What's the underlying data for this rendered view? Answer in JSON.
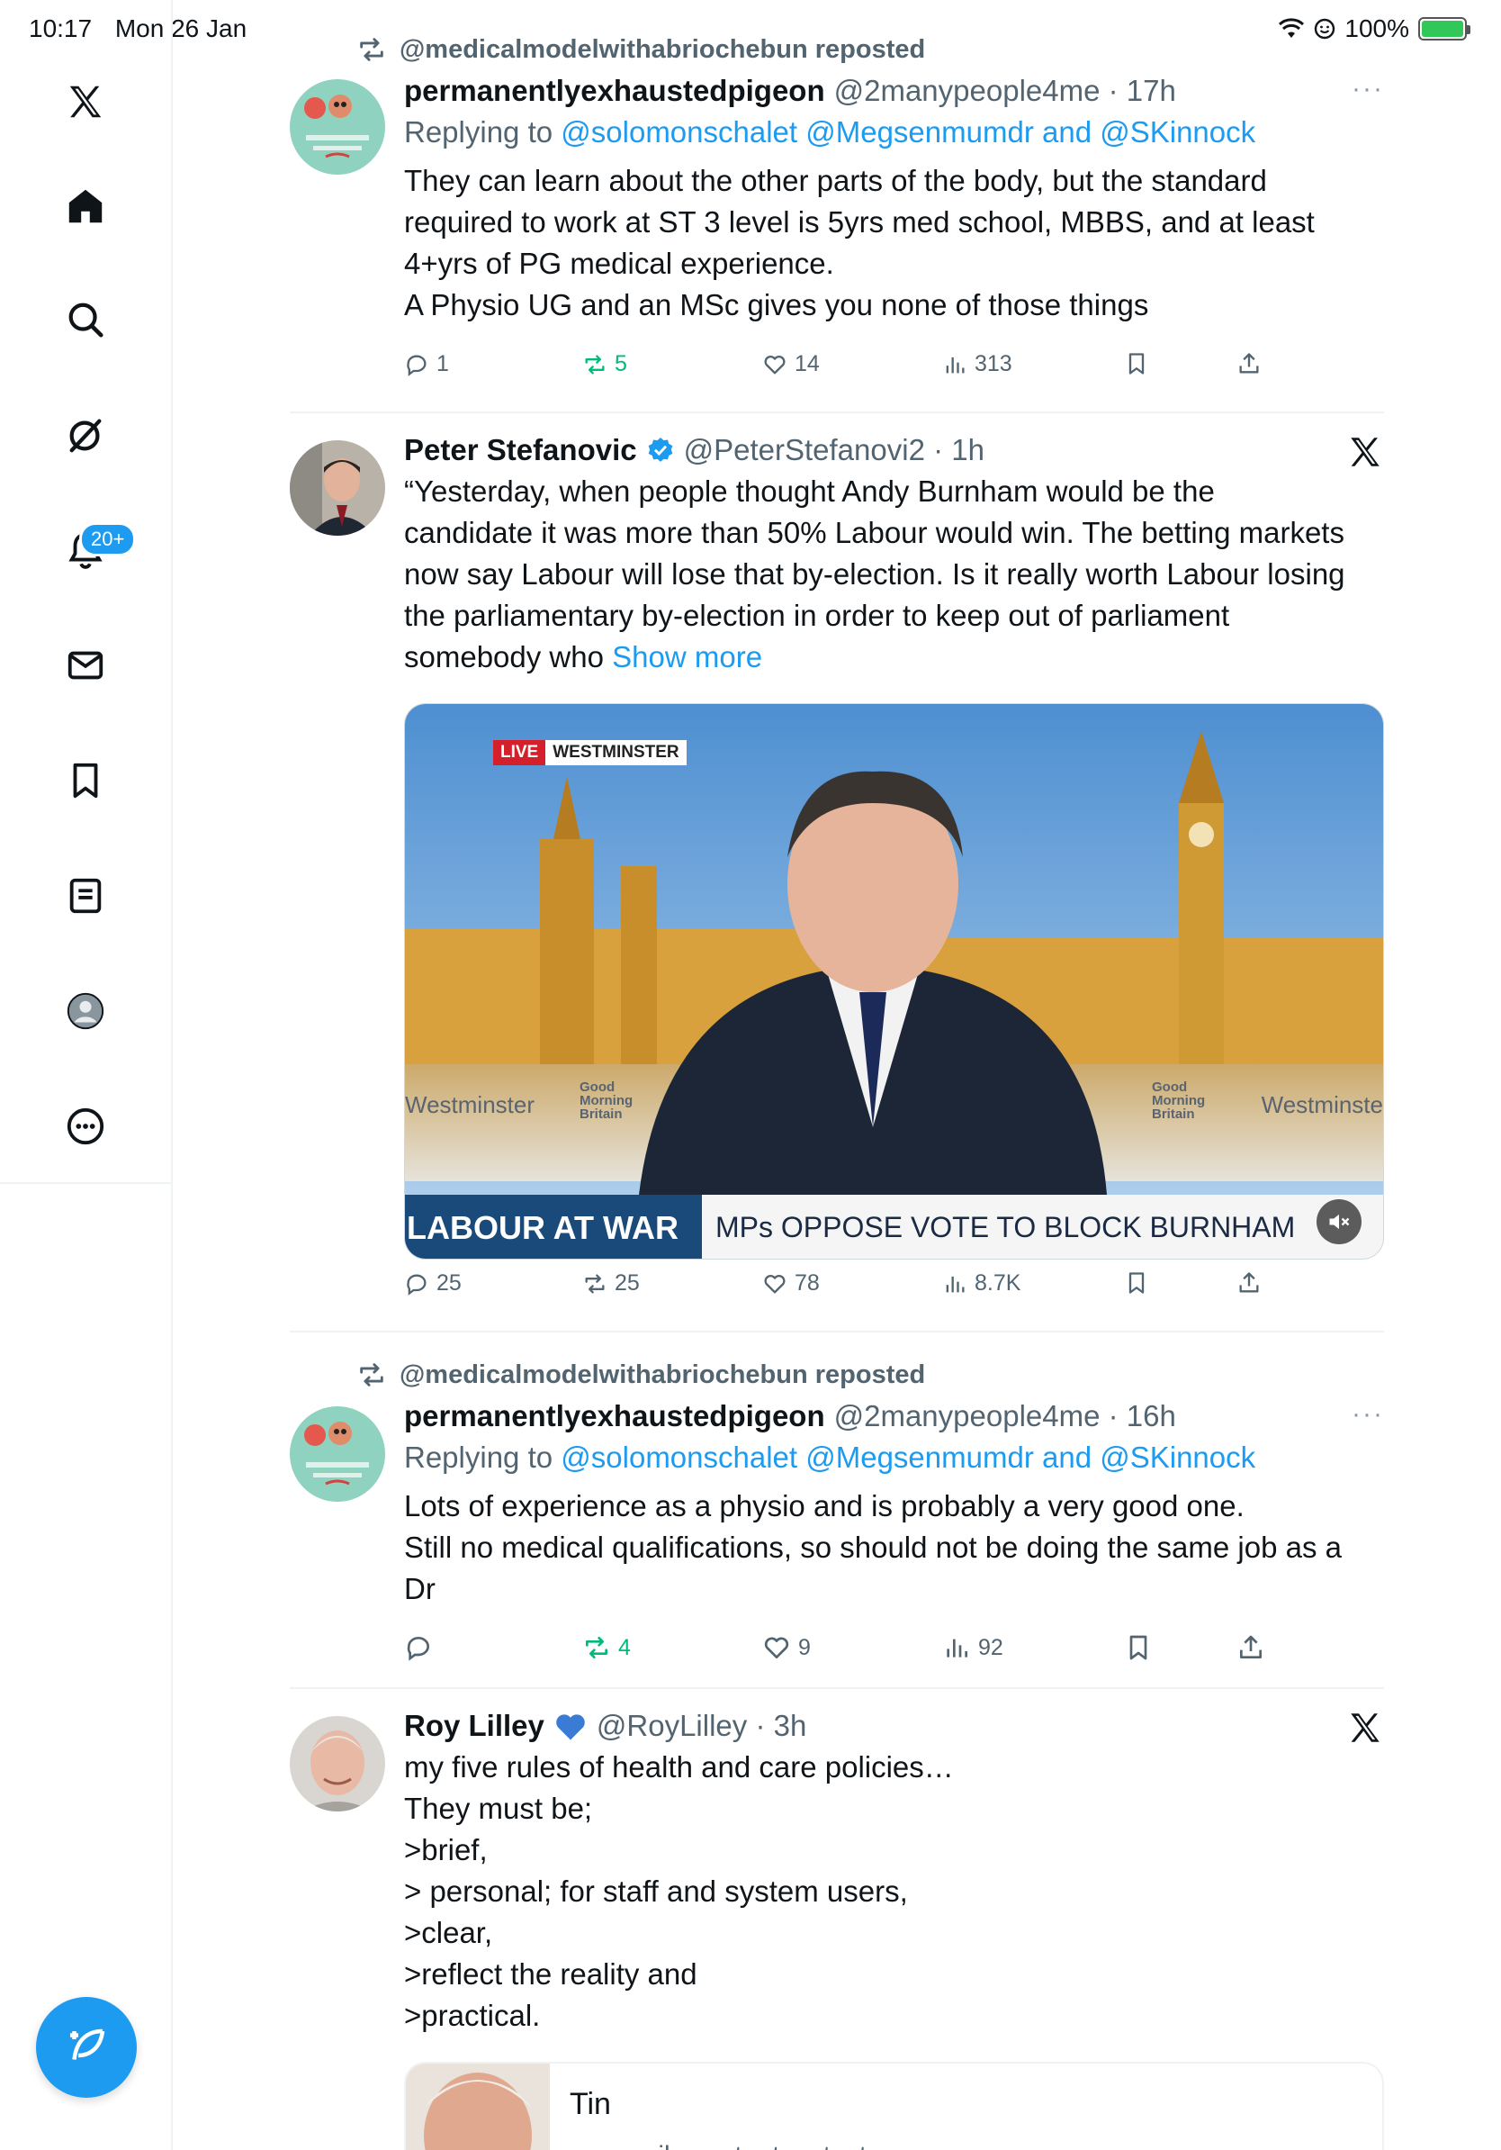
{
  "status": {
    "time": "10:17",
    "date": "Mon 26 Jan",
    "battery": "100%"
  },
  "sidebar": {
    "notifications_badge": "20+",
    "items": [
      "x-logo",
      "home",
      "search",
      "grok",
      "notifications",
      "messages",
      "bookmarks",
      "lists",
      "profile",
      "more"
    ]
  },
  "tweets": [
    {
      "repost_label": "@medicalmodelwithabriochebun reposted",
      "name": "permanentlyexhaustedpigeon",
      "handle": "@2manypeople4me · 17h",
      "replying_prefix": "Replying to",
      "replying_to": "@solomonschalet @Megsenmumdr and @SKinnock",
      "lines": [
        "They can learn about the other parts of the body, but the standard",
        "required to work at ST 3 level is 5yrs med school, MBBS, and at least",
        "4+yrs of PG medical experience.",
        "A Physio UG and an MSc gives you none of those things"
      ],
      "replies": "1",
      "reposts": "5",
      "likes": "14",
      "views": "313",
      "more": "···"
    },
    {
      "name": "Peter Stefanovic",
      "handle": "@PeterStefanovi2 · 1h",
      "lines": [
        "“Yesterday, when people thought Andy Burnham would be the",
        "candidate it was more than 50% Labour would win. The betting markets",
        "now say Labour will lose that by-election. Is it really worth Labour losing",
        "the parliamentary by-election in order to keep out of parliament"
      ],
      "last_line": "somebody who",
      "show_more": "Show more",
      "media": {
        "live": "LIVE",
        "location": "WESTMINSTER",
        "ticker_left": "LABOUR AT WAR",
        "ticker_right": "MPs OPPOSE VOTE TO BLOCK BURNHAM",
        "watermark_left": "Westminster",
        "watermark_right": "Westminste",
        "brand_line1": "Good",
        "brand_line2": "Morning",
        "brand_line3": "Britain"
      },
      "replies": "25",
      "reposts": "25",
      "likes": "78",
      "views": "8.7K"
    },
    {
      "repost_label": "@medicalmodelwithabriochebun reposted",
      "name": "permanentlyexhaustedpigeon",
      "handle": "@2manypeople4me · 16h",
      "replying_prefix": "Replying to",
      "replying_to": "@solomonschalet @Megsenmumdr and @SKinnock",
      "lines": [
        "Lots of experience as a physio and is probably a very good one.",
        "Still no medical qualifications, so should not be doing the same job as a",
        "Dr"
      ],
      "replies": "",
      "reposts": "4",
      "likes": "9",
      "views": "92",
      "more": "···"
    },
    {
      "name": "Roy Lilley",
      "handle": "@RoyLilley · 3h",
      "lines": [
        "my five rules of health and care policies…",
        "They must be;",
        ">brief,",
        "> personal; for staff and system users,",
        ">clear,",
        ">reflect the reality and",
        ">practical."
      ],
      "card_title": "Tin",
      "card_domain": "myemail.constantcontact.com"
    }
  ],
  "colors": {
    "accent": "#1d9bf0",
    "repost_green": "#00ba7c",
    "secondary_text": "#536471"
  }
}
